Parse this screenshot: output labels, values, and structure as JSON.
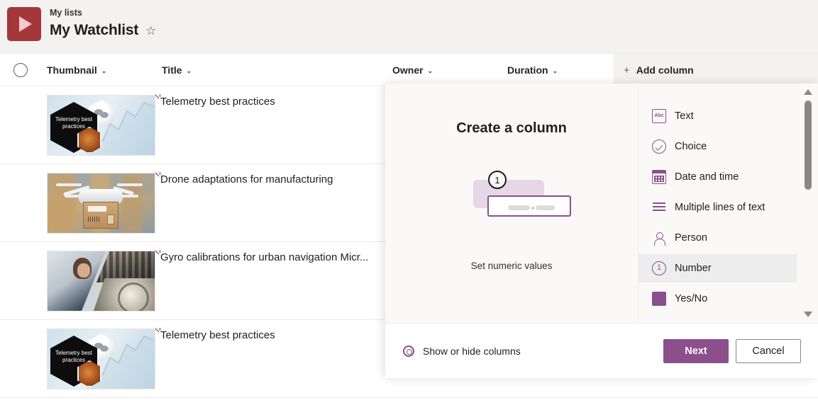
{
  "header": {
    "breadcrumb": "My lists",
    "title": "My Watchlist",
    "favorite_icon": "☆",
    "logo_icon": "play-icon",
    "logo_color": "#a4373a"
  },
  "list": {
    "select_all_icon": "circle-icon",
    "columns": [
      {
        "label": "Thumbnail",
        "chevron": "⌄"
      },
      {
        "label": "Title",
        "chevron": "⌄"
      },
      {
        "label": "Owner",
        "chevron": "⌄"
      },
      {
        "label": "Duration",
        "chevron": "⌄"
      }
    ],
    "add_column": {
      "plus": "+",
      "label": "Add column"
    },
    "rows": [
      {
        "title": "Telemetry best practices",
        "thumbnail": "telemetry-hexagons",
        "hex_text": "Telemetry best practices"
      },
      {
        "title": "Drone adaptations for manufacturing",
        "thumbnail": "drone-package"
      },
      {
        "title": "Gyro calibrations for urban navigation Micr...",
        "thumbnail": "gyro-collage"
      },
      {
        "title": "Telemetry best practices",
        "thumbnail": "telemetry-hexagons",
        "hex_text": "Telemetry best practices"
      }
    ]
  },
  "dialog": {
    "heading": "Create a column",
    "illustration_number": "1",
    "illustration_caption": "Set numeric values",
    "accent_color": "#8b4f8b",
    "options": [
      {
        "label": "Text",
        "icon": "abc-icon",
        "glyph": "Abc",
        "selected": false
      },
      {
        "label": "Choice",
        "icon": "check-circle-icon",
        "glyph": "",
        "selected": false
      },
      {
        "label": "Date and time",
        "icon": "calendar-icon",
        "glyph": "",
        "selected": false
      },
      {
        "label": "Multiple lines of text",
        "icon": "lines-icon",
        "glyph": "",
        "selected": false
      },
      {
        "label": "Person",
        "icon": "person-icon",
        "glyph": "",
        "selected": false
      },
      {
        "label": "Number",
        "icon": "number-circle-icon",
        "glyph": "1",
        "selected": true
      },
      {
        "label": "Yes/No",
        "icon": "toggle-icon",
        "glyph": "↔",
        "selected": false
      }
    ],
    "footer": {
      "show_hide_label": "Show or hide columns",
      "gear_icon": "gear-icon",
      "next_label": "Next",
      "cancel_label": "Cancel"
    }
  }
}
